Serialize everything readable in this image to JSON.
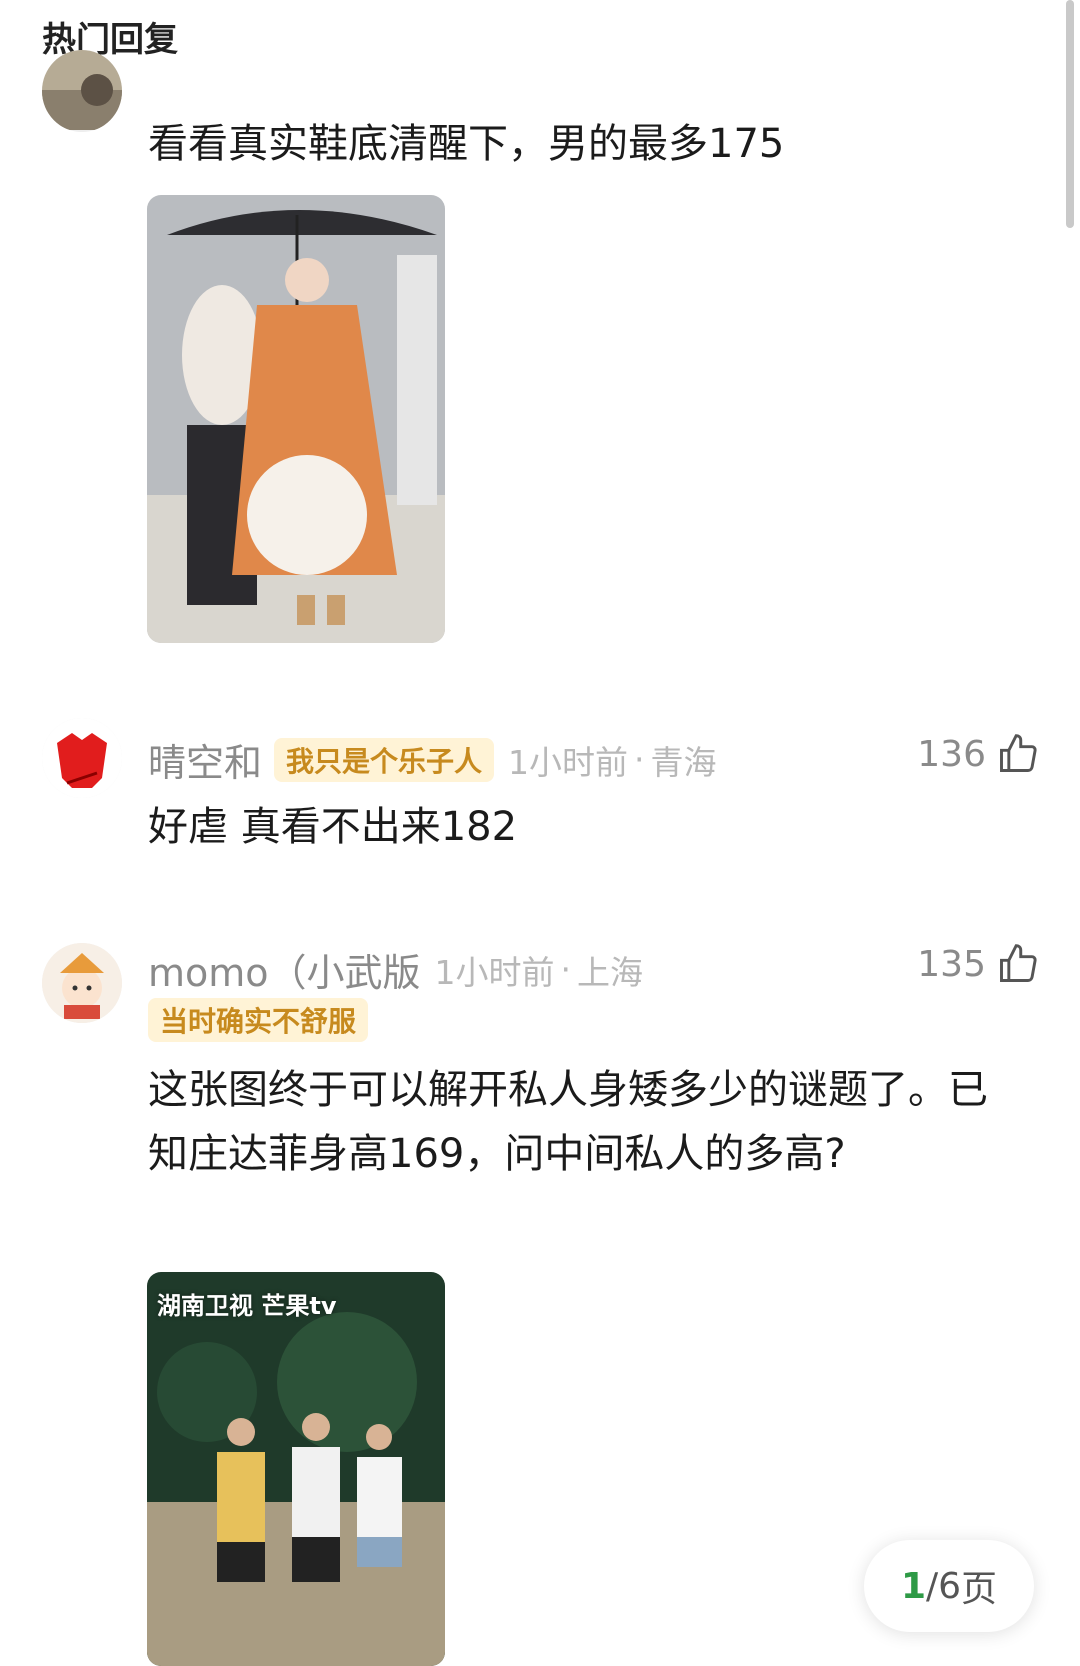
{
  "header": {
    "title": "热门回复"
  },
  "comments": [
    {
      "text": "看看真实鞋底清醒下，男的最多175"
    },
    {
      "username": "晴空和",
      "tag": "我只是个乐子人",
      "time": "1小时前",
      "location": "青海",
      "likes": "136",
      "text": "好虐 真看不出来182"
    },
    {
      "username": "momo（小武版",
      "tag": "当时确实不舒服",
      "time": "1小时前",
      "location": "上海",
      "likes": "135",
      "text": "这张图终于可以解开私人身矮多少的谜题了。已知庄达菲身高169，问中间私人的多高?",
      "image_caption": "湖南卫视 芒果tv"
    }
  ],
  "pager": {
    "current": "1",
    "total": "/6",
    "suffix": " 页"
  },
  "colors": {
    "tag_bg": "#fff3d6",
    "tag_text": "#c78a1e",
    "pager_current": "#2e9a46"
  }
}
